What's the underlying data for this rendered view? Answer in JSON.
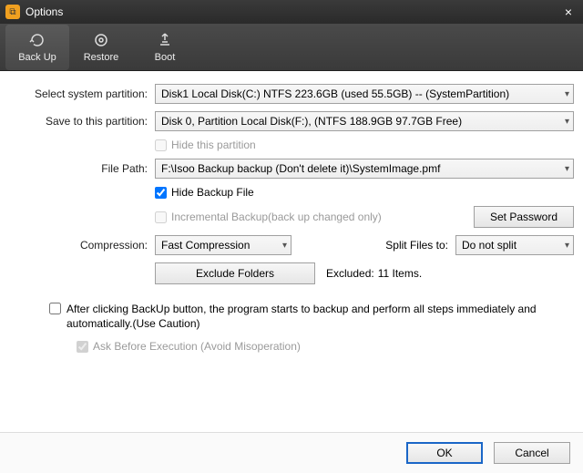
{
  "window": {
    "title": "Options"
  },
  "toolbar": {
    "backup": "Back Up",
    "restore": "Restore",
    "boot": "Boot"
  },
  "labels": {
    "select_partition": "Select system partition:",
    "save_to": "Save to this partition:",
    "file_path": "File Path:",
    "compression": "Compression:",
    "split_files": "Split Files to:",
    "excluded_prefix": "Excluded:",
    "excluded_count": "11 Items."
  },
  "values": {
    "system_partition": "Disk1 Local Disk(C:) NTFS 223.6GB (used 55.5GB) -- (SystemPartition)",
    "dest_partition": "Disk 0, Partition Local Disk(F:), (NTFS 188.9GB 97.7GB Free)",
    "file_path": "F:\\Isoo Backup backup (Don't delete it)\\SystemImage.pmf",
    "compression": "Fast Compression",
    "split": "Do not split"
  },
  "checkboxes": {
    "hide_partition": "Hide this partition",
    "hide_backup": "Hide Backup File",
    "incremental": "Incremental Backup(back up changed only)",
    "auto_run": "After clicking BackUp button, the program starts to backup and perform all steps immediately and automatically.(Use Caution)",
    "ask_before": "Ask Before Execution (Avoid Misoperation)"
  },
  "buttons": {
    "set_password": "Set Password",
    "exclude_folders": "Exclude Folders",
    "ok": "OK",
    "cancel": "Cancel"
  }
}
